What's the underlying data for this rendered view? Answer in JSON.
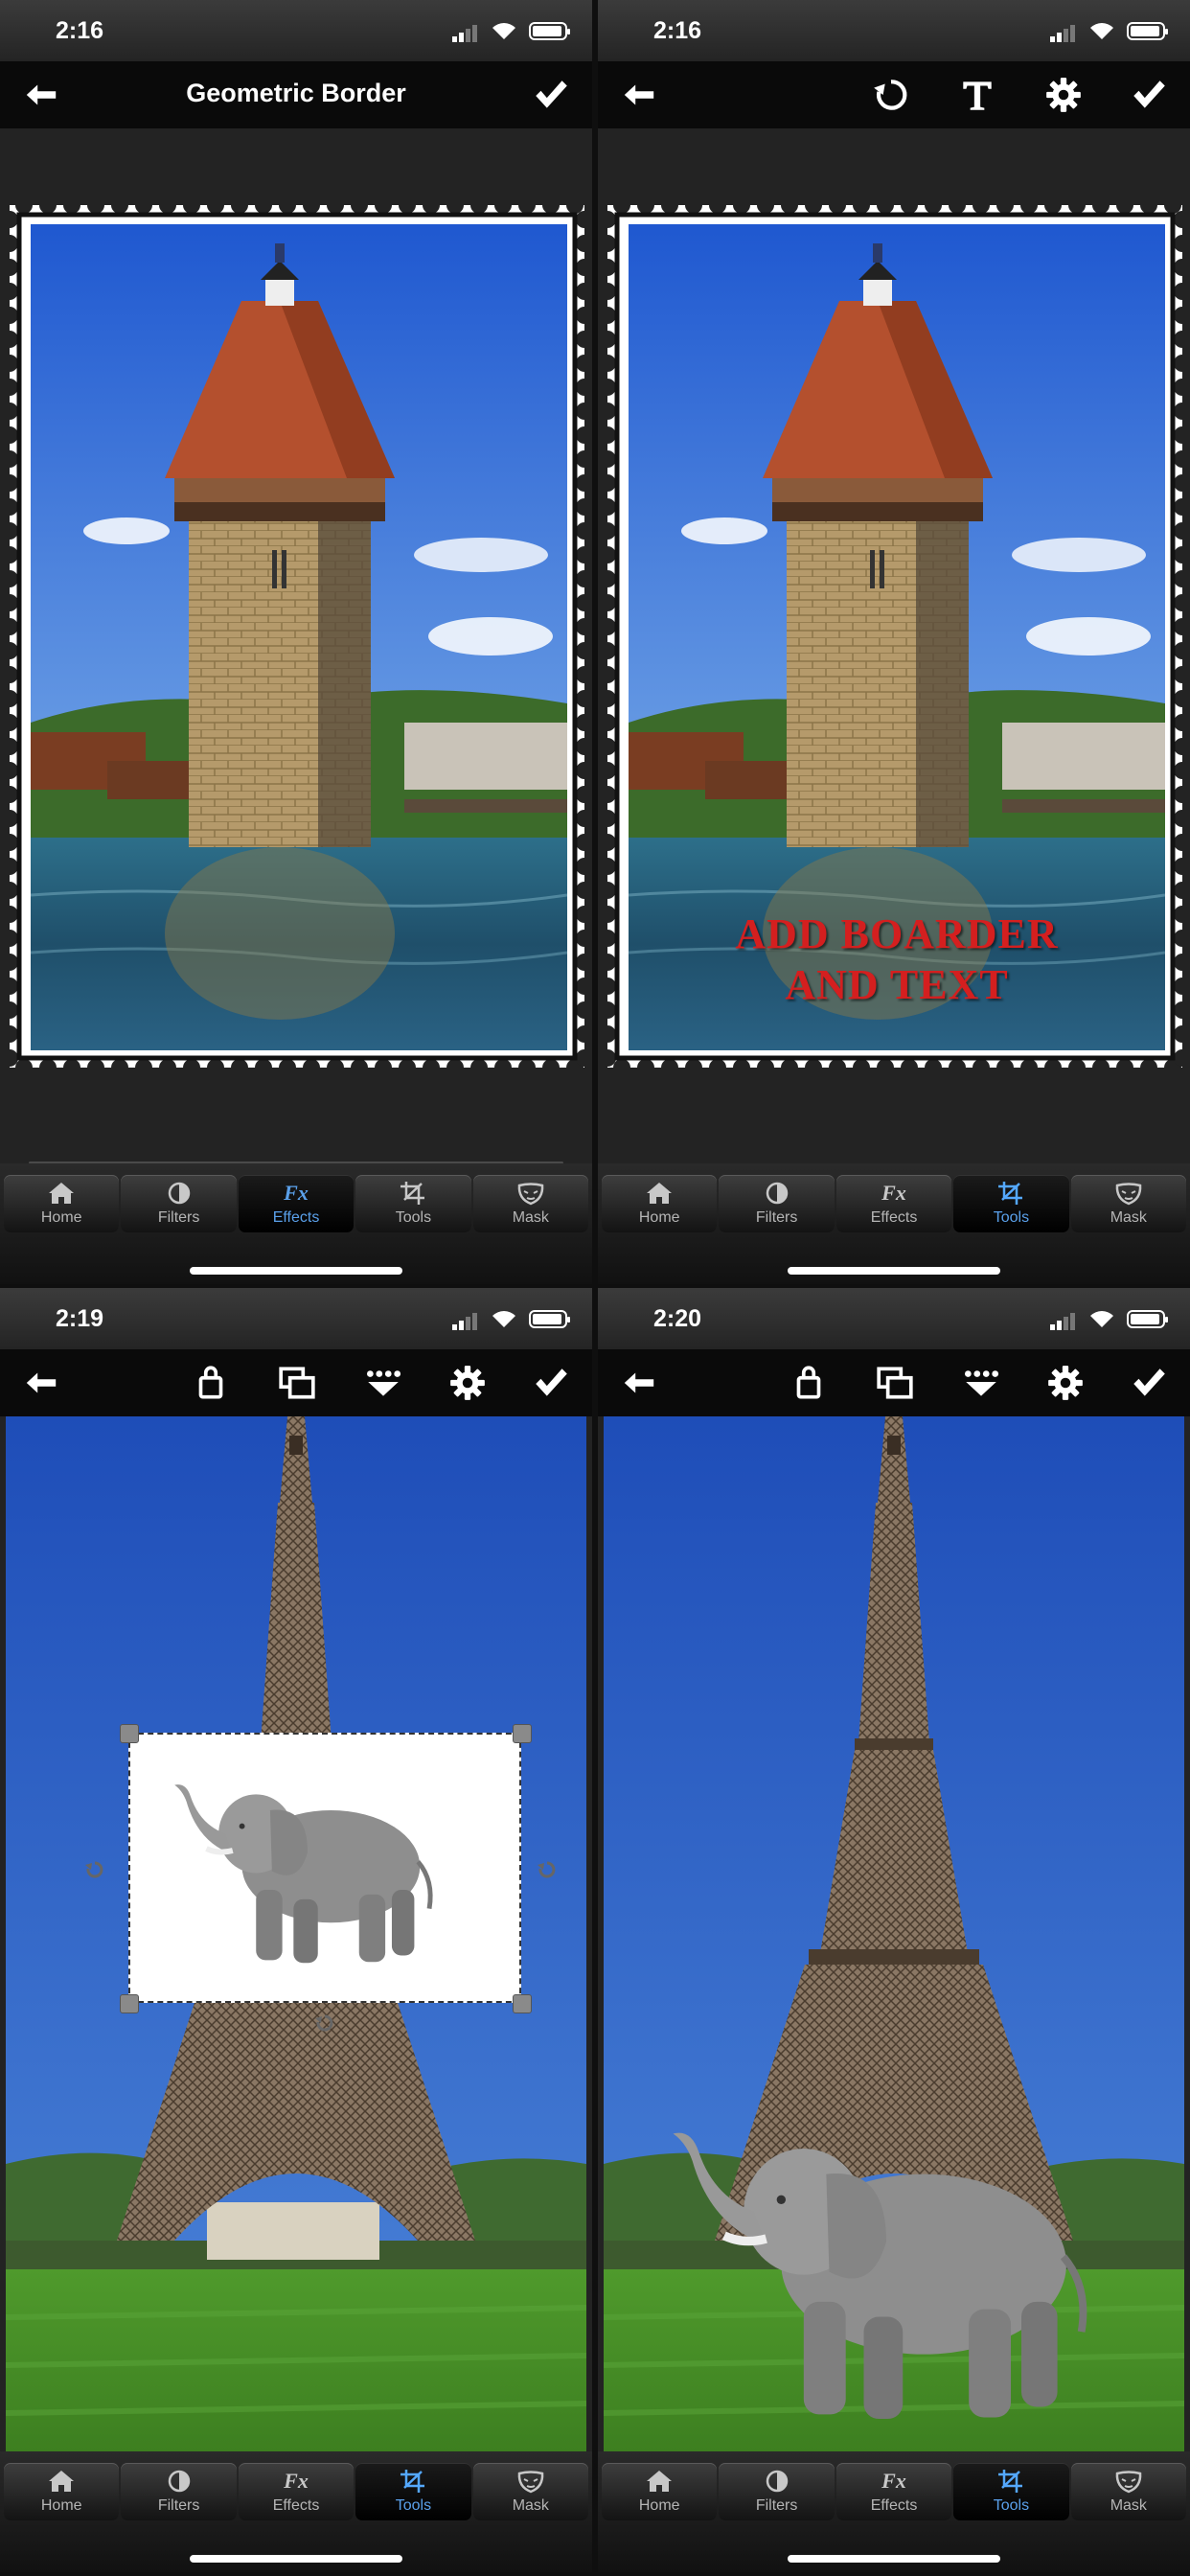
{
  "panels": [
    {
      "status": {
        "time": "2:16"
      },
      "toolbar": {
        "title": "Geometric Border",
        "icons": [
          "back-arrow-icon",
          "checkmark-icon"
        ]
      },
      "active_tab": "Effects"
    },
    {
      "status": {
        "time": "2:16"
      },
      "toolbar": {
        "title": "",
        "icons": [
          "back-arrow-icon",
          "rotate-icon",
          "text-icon",
          "gear-icon",
          "checkmark-icon"
        ]
      },
      "overlay_text": {
        "line1": "ADD BOARDER",
        "line2": "AND TEXT",
        "color": "#d41f1f"
      },
      "active_tab": "Tools"
    },
    {
      "status": {
        "time": "2:19"
      },
      "toolbar": {
        "title": "",
        "icons": [
          "back-arrow-icon",
          "bag-icon",
          "layers-icon",
          "points-icon",
          "gear-icon",
          "checkmark-icon"
        ]
      },
      "active_tab": "Tools"
    },
    {
      "status": {
        "time": "2:20"
      },
      "toolbar": {
        "title": "",
        "icons": [
          "back-arrow-icon",
          "bag-icon",
          "layers-icon",
          "points-icon",
          "gear-icon",
          "checkmark-icon"
        ]
      },
      "active_tab": "Tools"
    }
  ],
  "tabs": [
    {
      "label": "Home",
      "icon": "home-icon"
    },
    {
      "label": "Filters",
      "icon": "filters-icon"
    },
    {
      "label": "Effects",
      "icon": "fx-icon"
    },
    {
      "label": "Tools",
      "icon": "crop-icon"
    },
    {
      "label": "Mask",
      "icon": "mask-icon"
    }
  ],
  "fx_glyph": "Fx",
  "colors": {
    "accent": "#5aa0ea",
    "bar": "#0a0a0a",
    "sky": "#2f62c7",
    "grass": "#4f9a2c"
  }
}
